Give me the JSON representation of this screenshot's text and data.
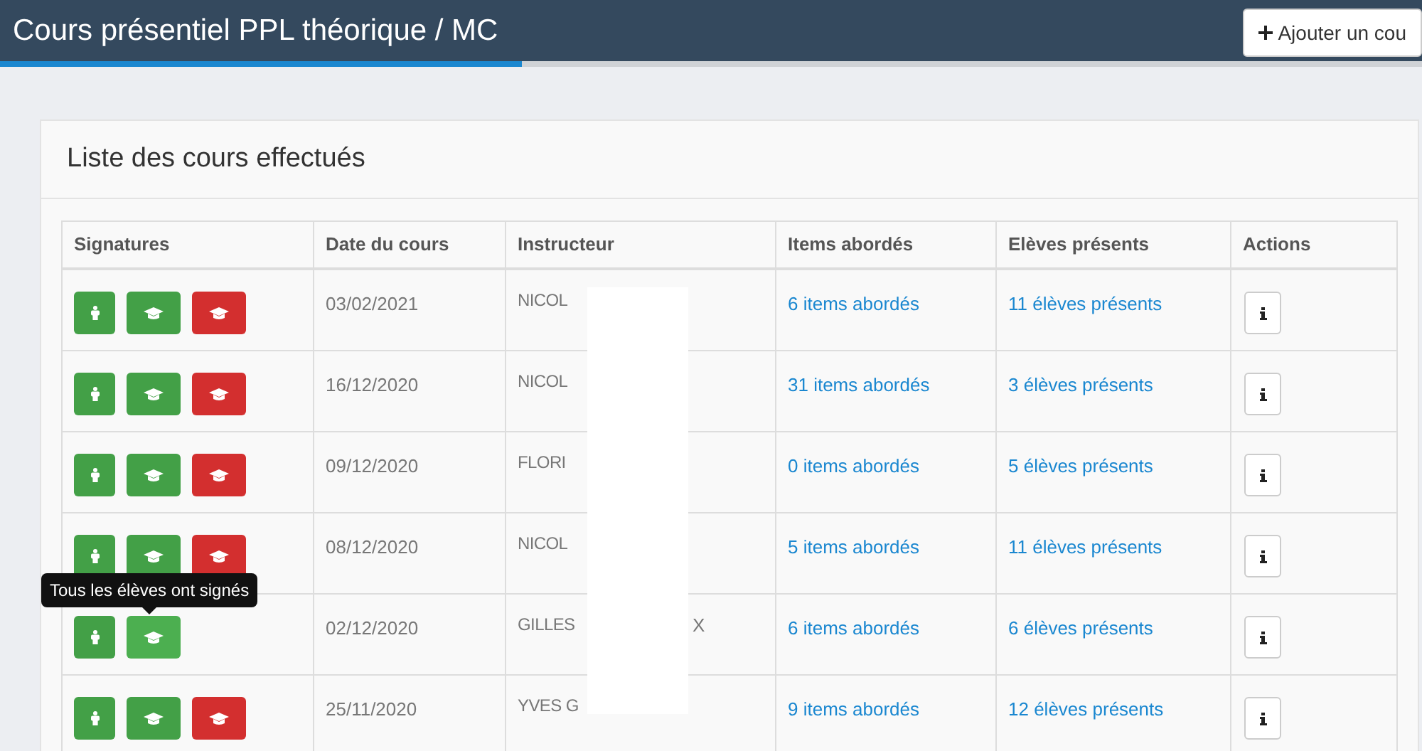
{
  "header": {
    "title": "Cours présentiel PPL théorique / MC",
    "progress": {
      "level": 0.367
    },
    "add_button": "Ajouter un cou"
  },
  "card": {
    "title": "Liste des cours effectués",
    "table": {
      "columns": [
        "Signatures",
        "Date du cours",
        "Instructeur",
        "Items abordés",
        "Elèves présents",
        "Actions"
      ],
      "rows": [
        {
          "signatures": [
            {
              "kind": "person",
              "color": "#43a047"
            },
            {
              "kind": "cap",
              "color": "#43a047"
            },
            {
              "kind": "cap",
              "color": "#d32f2f"
            }
          ],
          "date": "03/02/2021",
          "instructor": "NICOL",
          "instructor_end": "",
          "items": "6 items abordés",
          "students": "11 élèves présents"
        },
        {
          "signatures": [
            {
              "kind": "person",
              "color": "#43a047"
            },
            {
              "kind": "cap",
              "color": "#43a047"
            },
            {
              "kind": "cap",
              "color": "#d32f2f"
            }
          ],
          "date": "16/12/2020",
          "instructor": "NICOL",
          "instructor_end": "",
          "items": "31 items abordés",
          "students": "3 élèves présents"
        },
        {
          "signatures": [
            {
              "kind": "person",
              "color": "#43a047"
            },
            {
              "kind": "cap",
              "color": "#43a047"
            },
            {
              "kind": "cap",
              "color": "#d32f2f"
            }
          ],
          "date": "09/12/2020",
          "instructor": "FLORI",
          "instructor_end": "",
          "items": "0 items abordés",
          "students": "5 élèves présents"
        },
        {
          "signatures": [
            {
              "kind": "person",
              "color": "#43a047"
            },
            {
              "kind": "cap",
              "color": "#43a047"
            },
            {
              "kind": "cap",
              "color": "#d32f2f"
            }
          ],
          "date": "08/12/2020",
          "instructor": "NICOL",
          "instructor_end": "",
          "items": "5 items abordés",
          "students": "11 élèves présents"
        },
        {
          "signatures": [
            {
              "kind": "person",
              "color": "#43a047"
            },
            {
              "kind": "cap",
              "color": "#4caf50",
              "tooltip": "Tous les élèves ont signés"
            }
          ],
          "date": "02/12/2020",
          "instructor": "GILLES",
          "instructor_end": "X",
          "items": "6 items abordés",
          "students": "6 élèves présents"
        },
        {
          "signatures": [
            {
              "kind": "person",
              "color": "#43a047"
            },
            {
              "kind": "cap",
              "color": "#43a047"
            },
            {
              "kind": "cap",
              "color": "#d32f2f"
            }
          ],
          "date": "25/11/2020",
          "instructor": "YVES G",
          "instructor_end": "",
          "items": "9 items abordés",
          "students": "12 élèves présents"
        }
      ]
    }
  }
}
